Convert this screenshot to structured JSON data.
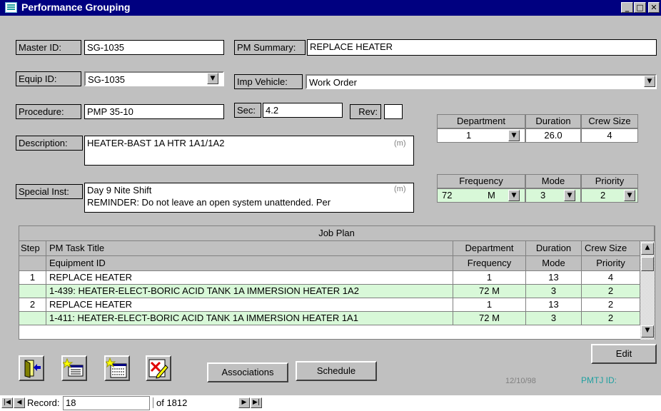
{
  "window": {
    "title": "Performance Grouping"
  },
  "form": {
    "master_id_label": "Master ID:",
    "master_id_value": "SG-1035",
    "pm_summary_label": "PM Summary:",
    "pm_summary_value": "REPLACE HEATER",
    "equip_id_label": "Equip ID:",
    "equip_id_value": "SG-1035",
    "imp_vehicle_label": "Imp Vehicle:",
    "imp_vehicle_value": "Work Order",
    "procedure_label": "Procedure:",
    "procedure_value": "PMP 35-10",
    "sec_label": "Sec:",
    "sec_value": "4.2",
    "rev_label": "Rev:",
    "rev_value": "",
    "description_label": "Description:",
    "description_value": "HEATER-BAST 1A HTR 1A1/1A2",
    "memo_marker": "(m)",
    "special_inst_label": "Special Inst:",
    "special_inst_line1": "Day 9 Nite Shift",
    "special_inst_line2": "REMINDER: Do not leave an open system unattended.  Per"
  },
  "summary_grid": {
    "department_header": "Department",
    "duration_header": "Duration",
    "crew_size_header": "Crew Size",
    "department": "1",
    "duration": "26.0",
    "crew_size": "4",
    "frequency_header": "Frequency",
    "mode_header": "Mode",
    "priority_header": "Priority",
    "frequency_num": "72",
    "frequency_unit": "M",
    "mode": "3",
    "priority": "2"
  },
  "job_plan": {
    "title": "Job Plan",
    "headers": {
      "step": "Step",
      "task_title": "PM Task Title",
      "equipment_id": "Equipment ID",
      "department": "Department",
      "frequency": "Frequency",
      "duration": "Duration",
      "mode": "Mode",
      "crew_size": "Crew Size",
      "priority": "Priority"
    },
    "rows": [
      {
        "step": "1",
        "task": "REPLACE HEATER",
        "department": "1",
        "duration": "13",
        "crew_size": "4",
        "equipment": "1-439: HEATER-ELECT-BORIC ACID TANK 1A IMMERSION HEATER 1A2",
        "frequency": "72 M",
        "mode": "3",
        "priority": "2"
      },
      {
        "step": "2",
        "task": "REPLACE HEATER",
        "department": "1",
        "duration": "13",
        "crew_size": "2",
        "equipment": "1-411: HEATER-ELECT-BORIC ACID TANK 1A IMMERSION HEATER 1A1",
        "frequency": "72 M",
        "mode": "3",
        "priority": "2"
      }
    ]
  },
  "buttons": {
    "edit": "Edit",
    "associations": "Associations",
    "schedule": "Schedule"
  },
  "footer": {
    "date": "12/10/98",
    "pmtj_label": "PMTJ ID:"
  },
  "record_nav": {
    "record_label": "Record:",
    "record_value": "18",
    "of_label": "of  1812"
  },
  "icons": [
    "exit-door-icon",
    "new-record-icon",
    "new-table-icon",
    "delete-edit-icon"
  ],
  "colors": {
    "title_bar": "#000080",
    "highlight_row": "#d8f8d8",
    "pmtj_text": "#20a0a0"
  }
}
